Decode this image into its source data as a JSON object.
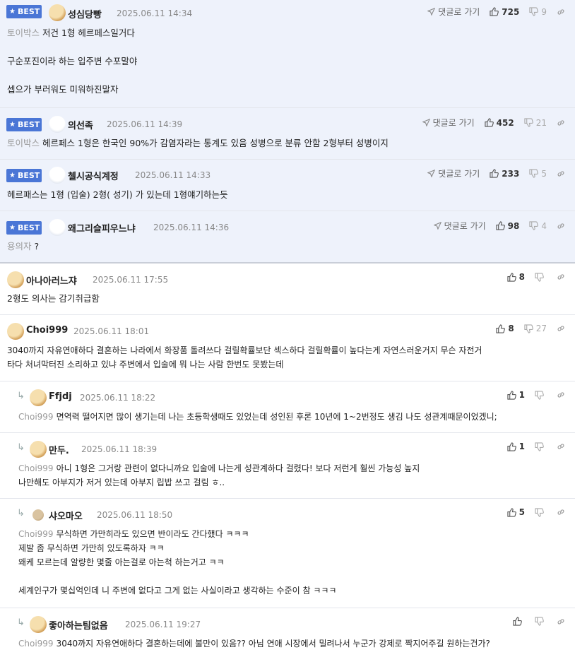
{
  "labels": {
    "best": "BEST",
    "reply_link": "댓글로 가기"
  },
  "colors": {
    "best_bg": "#eef2fb",
    "badge": "#4a76d6"
  },
  "icons": [
    "star-icon",
    "thumb-up-icon",
    "thumb-down-icon",
    "link-icon",
    "reply-arrow-icon",
    "navigate-icon"
  ],
  "best_comments": [
    {
      "nick": "성심당빵",
      "time": "2025.06.11 14:34",
      "up": "725",
      "down": "9",
      "ref": "토이박스",
      "text": "저건 1형 헤르페스일거다\n\n구순포진이라 하는 입주변 수포말야\n\n셉으가 부러워도 미워하진말자"
    },
    {
      "nick": "의선족",
      "time": "2025.06.11 14:39",
      "up": "452",
      "down": "21",
      "ref": "토이박스",
      "text": "헤르페스 1형은 한국인 90%가 감염자라는 통계도 있음 성병으로 분류 안함 2형부터 성병이지"
    },
    {
      "nick": "첼시공식계정",
      "time": "2025.06.11 14:33",
      "up": "233",
      "down": "5",
      "ref": "",
      "text": "헤르패스는 1형 (입술) 2형( 성기) 가 있는데 1형얘기하는듯"
    },
    {
      "nick": "왜그리슬피우느냐",
      "time": "2025.06.11 14:36",
      "up": "98",
      "down": "4",
      "ref": "용의자",
      "text": "?"
    }
  ],
  "comments": [
    {
      "nick": "아나아러느쟈",
      "time": "2025.06.11 17:55",
      "up": "8",
      "down": "",
      "ref": "",
      "text": "2형도 의사는 감기취급함"
    },
    {
      "nick": "Choi999",
      "time": "2025.06.11 18:01",
      "up": "8",
      "down": "27",
      "ref": "",
      "text": "3040까지 자유연애하다 결혼하는 나라에서 화장품 돌려쓰다 걸릴확률보단 섹스하다 걸릴확률이 높다는게 자연스러운거지 무슨 자전거\n타다 처녀막터진 소리하고 있냐 주변에서 입술에 뭐 나는 사람 한번도 못봤는데"
    }
  ],
  "replies": [
    {
      "nick": "Ffjdj",
      "time": "2025.06.11 18:22",
      "up": "1",
      "ref": "Choi999",
      "text": "면역력 떨어지면 많이 생기는데 나는 초등학생때도 있었는데 성인된 후론 10년에 1~2번정도 생김 나도 성관계때문이었겠니;"
    },
    {
      "nick": "만두.",
      "time": "2025.06.11 18:39",
      "up": "1",
      "ref": "Choi999",
      "text": "아니 1형은 그거랑 관련이 없다니까요 입술에 나는게 성관계하다 걸렸다! 보다 저런게 훨씬 가능성 높지\n나만해도 아부지가 저거 있는데 아부지 립밥 쓰고 걸림 ㅎ.."
    },
    {
      "nick": "샤오마오",
      "time": "2025.06.11 18:50",
      "up": "5",
      "ref": "Choi999",
      "text": "무식하면 가만히라도 있으면 반이라도 간다했다 ㅋㅋㅋ\n제발 좀 무식하면 가만히 있도록하자 ㅋㅋ\n왜케 모르는데 알량한 몇줄 아는걸로 아는척 하는거고 ㅋㅋ\n\n세계인구가 몇십억인데 니 주변에 없다고 그게 없는 사실이라고 생각하는 수준이 참 ㅋㅋㅋ"
    },
    {
      "nick": "좋아하는팀없음",
      "time": "2025.06.11 19:27",
      "up": "",
      "ref": "Choi999",
      "text": "3040까지 자유연애하다 결혼하는데에 불만이 있음?? 아님 연애 시장에서 밀려나서 누군가 강제로 짝지어주길 원하는건가?"
    }
  ]
}
